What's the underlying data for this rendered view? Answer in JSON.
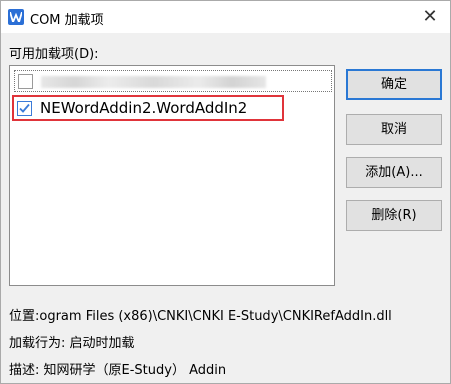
{
  "window": {
    "title": "COM 加载项",
    "close_glyph": "✕"
  },
  "addins": {
    "label": "可用加载项(D):",
    "items": [
      {
        "name": "",
        "checked": false,
        "blurred": true
      },
      {
        "name": "NEWordAddin2.WordAddIn2",
        "checked": true,
        "blurred": false
      }
    ]
  },
  "buttons": {
    "ok": "确定",
    "cancel": "取消",
    "add": "添加(A)...",
    "remove": "删除(R)"
  },
  "details": {
    "location": "位置:ogram Files (x86)\\CNKI\\CNKI E-Study\\CNKIRefAddIn.dll",
    "load_behavior": "加载行为: 启动时加载",
    "description": "描述: 知网研学（原E-Study） Addin"
  },
  "colors": {
    "highlight_box": "#e0343a",
    "default_button_border": "#2a78d4",
    "checkbox_check": "#3b7bd8"
  },
  "icons": {
    "app": "wps-writer-icon",
    "close": "close-icon",
    "check": "checkmark-icon"
  }
}
